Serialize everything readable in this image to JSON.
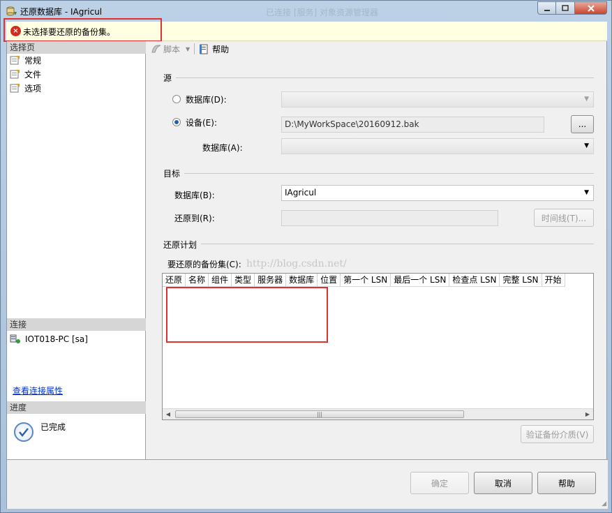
{
  "window": {
    "title": "还原数据库 - IAgricul",
    "title_ghost": "已连接 [服务] 对象资源管理器"
  },
  "error": {
    "message": "未选择要还原的备份集。",
    "icon": "error-icon"
  },
  "left": {
    "select_page_header": "选择页",
    "pages": [
      {
        "label": "常规",
        "icon": "page-settings-icon"
      },
      {
        "label": "文件",
        "icon": "page-settings-icon"
      },
      {
        "label": "选项",
        "icon": "page-settings-icon"
      }
    ],
    "connection_header": "连接",
    "connection_server": "IOT018-PC [sa]",
    "view_connection_link": "查看连接属性",
    "progress_header": "进度",
    "progress_status": "已完成"
  },
  "toolbar": {
    "script_label": "脚本",
    "help_label": "帮助"
  },
  "source": {
    "group_label": "源",
    "database_radio_label": "数据库(D):",
    "device_radio_label": "设备(E):",
    "device_path": "D:\\MyWorkSpace\\20160912.bak",
    "browse_label": "...",
    "device_db_label": "数据库(A):",
    "selected_radio": "device"
  },
  "destination": {
    "group_label": "目标",
    "database_label": "数据库(B):",
    "database_value": "IAgricul",
    "restore_to_label": "还原到(R):",
    "restore_to_value": "",
    "timeline_label": "时间线(T)..."
  },
  "plan": {
    "group_label": "还原计划",
    "backupsets_label": "要还原的备份集(C):",
    "watermark": "http://blog.csdn.net/",
    "columns": [
      "还原",
      "名称",
      "组件",
      "类型",
      "服务器",
      "数据库",
      "位置",
      "第一个 LSN",
      "最后一个 LSN",
      "检查点 LSN",
      "完整 LSN",
      "开始"
    ],
    "rows": [],
    "verify_label": "验证备份介质(V)"
  },
  "footer": {
    "ok_label": "确定",
    "cancel_label": "取消",
    "help_label": "帮助"
  },
  "colors": {
    "error_bg": "#ffffe1",
    "highlight_red": "#e03030",
    "link": "#0033cc"
  }
}
